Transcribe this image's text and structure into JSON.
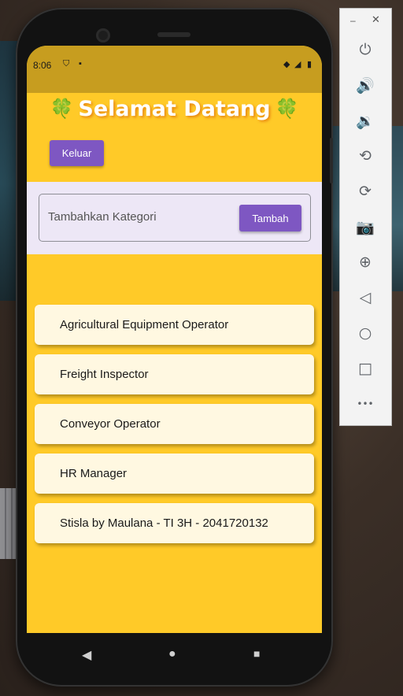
{
  "status_bar": {
    "time": "8:06"
  },
  "header": {
    "title": "Selamat Datang",
    "leaf_icon": "🍀"
  },
  "logout_button": {
    "label": "Keluar"
  },
  "add_category": {
    "placeholder": "Tambahkan Kategori",
    "button_label": "Tambah"
  },
  "categories": [
    {
      "name": "Agricultural Equipment Operator"
    },
    {
      "name": "Freight Inspector"
    },
    {
      "name": "Conveyor Operator"
    },
    {
      "name": "HR Manager"
    },
    {
      "name": "Stisla by Maulana - TI 3H - 2041720132"
    }
  ],
  "colors": {
    "accent": "#7e57c2",
    "background": "#ffca28",
    "item_bg": "#fff8e1",
    "status_bar": "#c79d1f"
  },
  "emulator_controls": [
    {
      "icon": "power-icon",
      "glyph": "⏻"
    },
    {
      "icon": "volume-up-icon",
      "glyph": "🔊"
    },
    {
      "icon": "volume-down-icon",
      "glyph": "🔉"
    },
    {
      "icon": "rotate-left-icon",
      "glyph": "⟲"
    },
    {
      "icon": "rotate-right-icon",
      "glyph": "⟳"
    },
    {
      "icon": "camera-icon",
      "glyph": "📷"
    },
    {
      "icon": "zoom-icon",
      "glyph": "⊕"
    },
    {
      "icon": "back-icon",
      "glyph": "◁"
    },
    {
      "icon": "home-icon",
      "glyph": "○"
    },
    {
      "icon": "overview-icon",
      "glyph": "□"
    },
    {
      "icon": "more-icon",
      "glyph": "•••"
    }
  ],
  "emulator_window": {
    "minimize_glyph": "–",
    "close_glyph": "✕"
  },
  "nav_bar": {
    "back_glyph": "◀",
    "home_glyph": "●",
    "recents_glyph": "■"
  }
}
